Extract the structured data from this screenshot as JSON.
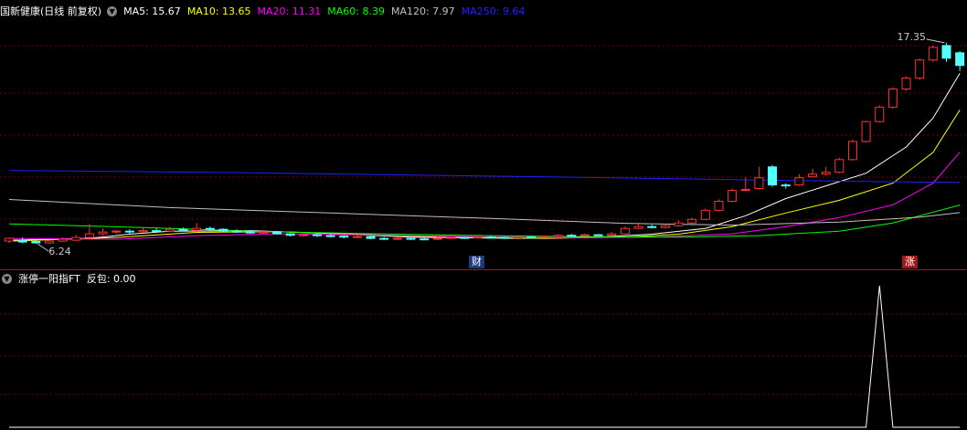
{
  "main_header": {
    "title": "国新健康(日线 前复权)",
    "ma": [
      {
        "label": "MA5: 15.67",
        "color": "#ffffff"
      },
      {
        "label": "MA10: 13.65",
        "color": "#ffff00"
      },
      {
        "label": "MA20: 11.31",
        "color": "#ff00ff"
      },
      {
        "label": "MA60: 8.39",
        "color": "#00ff00"
      },
      {
        "label": "MA120: 7.97",
        "color": "#c0c0c0"
      },
      {
        "label": "MA250: 9.64",
        "color": "#2020ff"
      }
    ]
  },
  "sub_header": {
    "title": "涨停一阳指FT",
    "value": "反包: 0.00"
  },
  "markers": {
    "finance": "财",
    "limit_up": "涨"
  },
  "chart_data": {
    "type": "candlestick",
    "high_label": "17.35",
    "low_label": "6.24",
    "ylim": [
      6.0,
      17.8
    ],
    "candles": [
      [
        6.4,
        6.55,
        6.6,
        6.3
      ],
      [
        6.45,
        6.35,
        6.6,
        6.28
      ],
      [
        6.38,
        6.3,
        6.5,
        6.24
      ],
      [
        6.3,
        6.4,
        6.45,
        6.25
      ],
      [
        6.4,
        6.5,
        6.6,
        6.35
      ],
      [
        6.45,
        6.6,
        6.75,
        6.4
      ],
      [
        6.6,
        6.8,
        7.35,
        6.55
      ],
      [
        6.8,
        6.9,
        7.1,
        6.7
      ],
      [
        6.9,
        6.95,
        7.0,
        6.8
      ],
      [
        6.95,
        6.9,
        7.05,
        6.8
      ],
      [
        6.92,
        6.98,
        7.1,
        6.85
      ],
      [
        6.98,
        6.95,
        7.1,
        6.85
      ],
      [
        6.95,
        7.05,
        7.2,
        6.9
      ],
      [
        7.05,
        7.0,
        7.15,
        6.95
      ],
      [
        7.0,
        7.1,
        7.4,
        6.95
      ],
      [
        7.1,
        7.05,
        7.2,
        6.95
      ],
      [
        7.05,
        6.95,
        7.1,
        6.9
      ],
      [
        6.95,
        6.92,
        7.05,
        6.85
      ],
      [
        6.92,
        6.85,
        6.98,
        6.8
      ],
      [
        6.85,
        6.9,
        6.95,
        6.8
      ],
      [
        6.9,
        6.8,
        6.95,
        6.75
      ],
      [
        6.8,
        6.72,
        6.85,
        6.65
      ],
      [
        6.72,
        6.75,
        6.82,
        6.65
      ],
      [
        6.75,
        6.7,
        6.8,
        6.62
      ],
      [
        6.7,
        6.68,
        6.78,
        6.6
      ],
      [
        6.68,
        6.62,
        6.72,
        6.55
      ],
      [
        6.62,
        6.65,
        6.72,
        6.55
      ],
      [
        6.65,
        6.55,
        6.7,
        6.5
      ],
      [
        6.55,
        6.5,
        6.62,
        6.45
      ],
      [
        6.5,
        6.55,
        6.62,
        6.45
      ],
      [
        6.55,
        6.52,
        6.6,
        6.45
      ],
      [
        6.52,
        6.5,
        6.58,
        6.45
      ],
      [
        6.5,
        6.55,
        6.62,
        6.45
      ],
      [
        6.55,
        6.6,
        6.68,
        6.5
      ],
      [
        6.6,
        6.58,
        6.65,
        6.52
      ],
      [
        6.58,
        6.62,
        6.7,
        6.55
      ],
      [
        6.62,
        6.6,
        6.68,
        6.55
      ],
      [
        6.6,
        6.58,
        6.65,
        6.52
      ],
      [
        6.58,
        6.62,
        6.68,
        6.55
      ],
      [
        6.62,
        6.6,
        6.7,
        6.55
      ],
      [
        6.6,
        6.65,
        6.72,
        6.58
      ],
      [
        6.65,
        6.72,
        6.8,
        6.6
      ],
      [
        6.72,
        6.7,
        6.8,
        6.65
      ],
      [
        6.7,
        6.75,
        6.82,
        6.65
      ],
      [
        6.75,
        6.72,
        6.8,
        6.68
      ],
      [
        6.72,
        6.8,
        6.9,
        6.7
      ],
      [
        6.8,
        7.1,
        7.2,
        6.78
      ],
      [
        7.1,
        7.2,
        7.35,
        7.05
      ],
      [
        7.2,
        7.15,
        7.3,
        7.1
      ],
      [
        7.15,
        7.25,
        7.35,
        7.1
      ],
      [
        7.25,
        7.4,
        7.55,
        7.2
      ],
      [
        7.4,
        7.6,
        7.7,
        7.35
      ],
      [
        7.6,
        8.1,
        8.2,
        7.55
      ],
      [
        8.1,
        8.6,
        8.7,
        8.05
      ],
      [
        8.6,
        9.2,
        9.3,
        8.55
      ],
      [
        9.2,
        9.25,
        9.9,
        9.15
      ],
      [
        9.3,
        9.9,
        10.5,
        9.25
      ],
      [
        10.5,
        9.5,
        10.6,
        9.4
      ],
      [
        9.5,
        9.45,
        9.6,
        9.3
      ],
      [
        9.5,
        9.9,
        10.1,
        9.45
      ],
      [
        9.95,
        10.1,
        10.4,
        9.9
      ],
      [
        10.1,
        10.2,
        10.5,
        10.0
      ],
      [
        10.2,
        10.9,
        11.0,
        10.15
      ],
      [
        10.9,
        11.9,
        12.0,
        10.85
      ],
      [
        11.9,
        13.0,
        13.05,
        11.85
      ],
      [
        13.0,
        13.8,
        13.9,
        12.95
      ],
      [
        13.8,
        14.8,
        14.9,
        13.7
      ],
      [
        14.8,
        15.4,
        15.5,
        14.7
      ],
      [
        15.4,
        16.4,
        16.5,
        15.3
      ],
      [
        16.4,
        17.1,
        17.2,
        16.3
      ],
      [
        17.2,
        16.5,
        17.35,
        16.3
      ],
      [
        16.8,
        16.1,
        16.9,
        15.8
      ]
    ],
    "series": [
      {
        "name": "MA5",
        "color": "#ffffff",
        "values": [
          [
            0,
            6.45
          ],
          [
            6,
            6.55
          ],
          [
            9,
            6.78
          ],
          [
            12,
            6.95
          ],
          [
            18,
            6.98
          ],
          [
            24,
            6.82
          ],
          [
            30,
            6.62
          ],
          [
            38,
            6.55
          ],
          [
            44,
            6.62
          ],
          [
            48,
            6.78
          ],
          [
            52,
            7.1
          ],
          [
            55,
            7.8
          ],
          [
            58,
            8.75
          ],
          [
            61,
            9.45
          ],
          [
            64,
            10.15
          ],
          [
            67,
            11.6
          ],
          [
            69,
            13.2
          ],
          [
            71,
            15.67
          ]
        ]
      },
      {
        "name": "MA10",
        "color": "#ffff00",
        "values": [
          [
            0,
            6.4
          ],
          [
            8,
            6.6
          ],
          [
            14,
            6.88
          ],
          [
            20,
            6.92
          ],
          [
            26,
            6.78
          ],
          [
            32,
            6.62
          ],
          [
            40,
            6.55
          ],
          [
            46,
            6.62
          ],
          [
            50,
            6.78
          ],
          [
            54,
            7.2
          ],
          [
            58,
            7.95
          ],
          [
            62,
            8.65
          ],
          [
            66,
            9.6
          ],
          [
            69,
            11.3
          ],
          [
            71,
            13.65
          ]
        ]
      },
      {
        "name": "MA20",
        "color": "#ff00ff",
        "values": [
          [
            0,
            6.55
          ],
          [
            8,
            6.5
          ],
          [
            14,
            6.7
          ],
          [
            20,
            6.8
          ],
          [
            26,
            6.75
          ],
          [
            34,
            6.65
          ],
          [
            42,
            6.58
          ],
          [
            48,
            6.62
          ],
          [
            54,
            6.8
          ],
          [
            58,
            7.2
          ],
          [
            62,
            7.7
          ],
          [
            66,
            8.4
          ],
          [
            69,
            9.6
          ],
          [
            71,
            11.31
          ]
        ]
      },
      {
        "name": "MA60",
        "color": "#00ff00",
        "values": [
          [
            0,
            7.35
          ],
          [
            10,
            7.15
          ],
          [
            18,
            6.95
          ],
          [
            26,
            6.82
          ],
          [
            34,
            6.72
          ],
          [
            42,
            6.65
          ],
          [
            50,
            6.62
          ],
          [
            56,
            6.7
          ],
          [
            62,
            6.95
          ],
          [
            66,
            7.4
          ],
          [
            71,
            8.39
          ]
        ]
      },
      {
        "name": "MA120",
        "color": "#c0c0c0",
        "values": [
          [
            0,
            8.7
          ],
          [
            12,
            8.25
          ],
          [
            24,
            7.95
          ],
          [
            36,
            7.65
          ],
          [
            46,
            7.38
          ],
          [
            54,
            7.28
          ],
          [
            62,
            7.45
          ],
          [
            68,
            7.72
          ],
          [
            71,
            7.97
          ]
        ]
      },
      {
        "name": "MA250",
        "color": "#2020ff",
        "values": [
          [
            0,
            10.3
          ],
          [
            15,
            10.2
          ],
          [
            30,
            10.05
          ],
          [
            45,
            9.9
          ],
          [
            58,
            9.75
          ],
          [
            65,
            9.68
          ],
          [
            71,
            9.64
          ]
        ]
      }
    ],
    "finance_marker_index": 36,
    "limit_up_marker_index": 69,
    "indicator": {
      "name": "反包",
      "color": "#ffffff",
      "values": [
        [
          0,
          0
        ],
        [
          64,
          0
        ],
        [
          65,
          1
        ],
        [
          66,
          0
        ],
        [
          71,
          0
        ]
      ]
    }
  }
}
